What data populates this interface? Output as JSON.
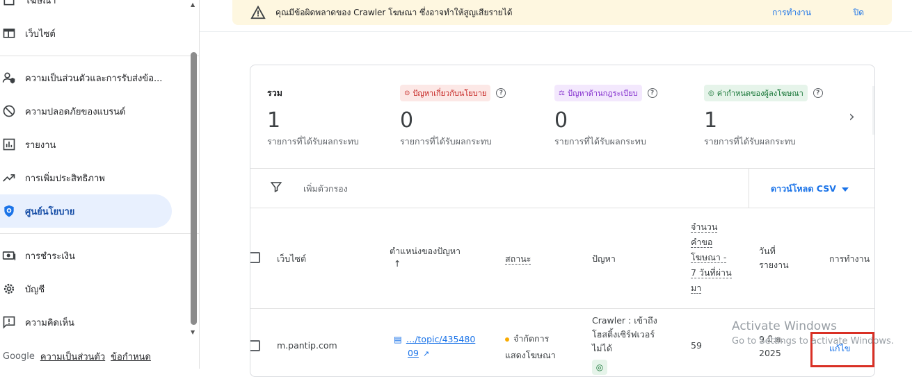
{
  "sidebar": {
    "items": [
      {
        "label": "โฆษณา",
        "icon": "ads-icon"
      },
      {
        "label": "เว็บไซต์",
        "icon": "web-icon"
      },
      {
        "label": "ความเป็นส่วนตัวและการรับส่งข้อ...",
        "icon": "privacy-icon"
      },
      {
        "label": "ความปลอดภัยของแบรนด์",
        "icon": "block-icon"
      },
      {
        "label": "รายงาน",
        "icon": "bar-chart-icon"
      },
      {
        "label": "การเพิ่มประสิทธิภาพ",
        "icon": "trending-icon"
      },
      {
        "label": "ศูนย์นโยบาย",
        "icon": "shield-icon"
      },
      {
        "label": "การชำระเงิน",
        "icon": "payments-icon"
      },
      {
        "label": "บัญชี",
        "icon": "settings-icon"
      },
      {
        "label": "ความคิดเห็น",
        "icon": "feedback-icon"
      }
    ]
  },
  "footer": {
    "brand": "Google",
    "privacy": "ความเป็นส่วนตัว",
    "terms": "ข้อกำหนด"
  },
  "banner": {
    "message": "คุณมีข้อผิดพลาดของ Crawler โฆษณา ซึ่งอาจทำให้สูญเสียรายได้",
    "action": "การทำงาน",
    "close": "ปิด"
  },
  "summary": {
    "total": {
      "label": "รวม",
      "value": "1",
      "sub": "รายการที่ได้รับผลกระทบ"
    },
    "policy": {
      "label": "ปัญหาเกี่ยวกับนโยบาย",
      "value": "0",
      "sub": "รายการที่ได้รับผลกระทบ"
    },
    "regulation": {
      "label": "ปัญหาด้านกฎระเบียบ",
      "value": "0",
      "sub": "รายการที่ได้รับผลกระทบ"
    },
    "advertiser": {
      "label": "ค่ากำหนดของผู้ลงโฆษณา",
      "value": "1",
      "sub": "รายการที่ได้รับผลกระทบ"
    }
  },
  "filter": {
    "placeholder": "เพิ่มตัวกรอง",
    "csv": "ดาวน์โหลด CSV"
  },
  "table": {
    "headers": {
      "site": "เว็บไซต์",
      "location": "ตำแหน่งของปัญหา",
      "status": "สถานะ",
      "issue": "ปัญหา",
      "requests": [
        "จำนวน",
        "คำขอ",
        "โฆษณา -",
        "7 วันที่ผ่าน",
        "มา"
      ],
      "reported": [
        "วันที่",
        "รายงาน"
      ],
      "action": "การทำงาน"
    },
    "rows": [
      {
        "site": "m.pantip.com",
        "location": [
          "…/topic/435480",
          "09"
        ],
        "status": [
          "จำกัดการ",
          "แสดงโฆษณา"
        ],
        "issue": [
          "Crawler : เข้าถึง",
          "โฮสติ้งเซิร์ฟเวอร์",
          "ไม่ได้"
        ],
        "requests": "59",
        "reported": [
          "9 มิ.ย.",
          "2025"
        ],
        "action": "แก้ไข"
      }
    ]
  },
  "watermark": {
    "line1": "Activate Windows",
    "line2": "Go to Settings to activate Windows."
  },
  "colors": {
    "accent": "#1a73e8",
    "activeNav": "#e8f0fe",
    "banner": "#fef7e0",
    "highlight": "#d93025"
  }
}
